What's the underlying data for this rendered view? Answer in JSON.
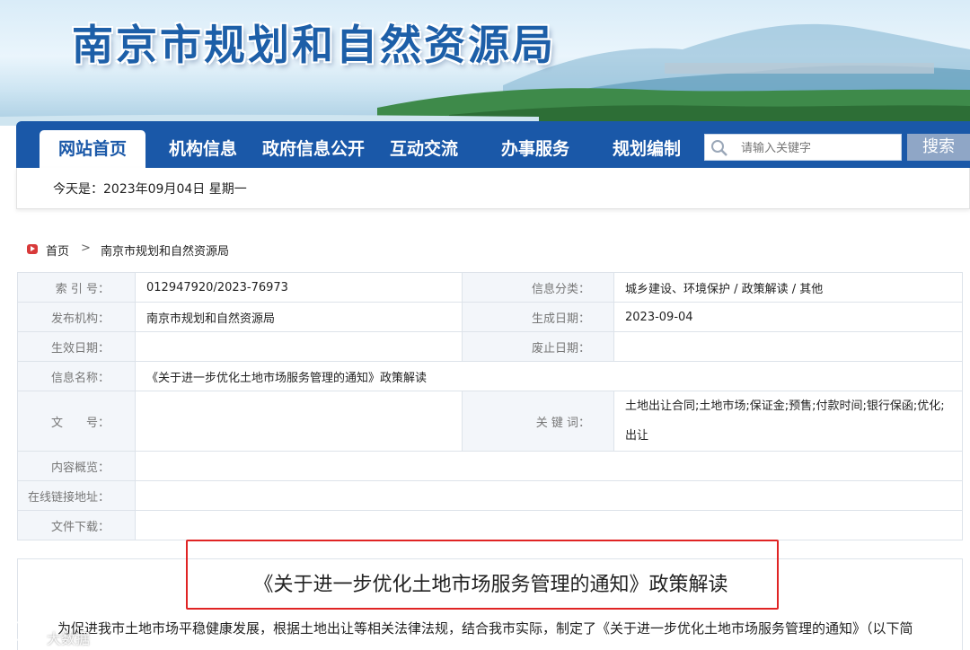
{
  "site": {
    "title": "南京市规划和自然资源局"
  },
  "nav": {
    "items": [
      {
        "label": "网站首页"
      },
      {
        "label": "机构信息"
      },
      {
        "label": "政府信息公开"
      },
      {
        "label": "互动交流"
      },
      {
        "label": "办事服务"
      },
      {
        "label": "规划编制"
      }
    ],
    "search_placeholder": "请输入关键字",
    "search_button": "搜索"
  },
  "datebar": {
    "text": "今天是：2023年09月04日  星期一"
  },
  "breadcrumb": {
    "home": "首页",
    "separator": ">",
    "current": "南京市规划和自然资源局"
  },
  "info": {
    "index_label": "索 引 号：",
    "index_value": "012947920/2023-76973",
    "category_label": "信息分类：",
    "category_value": "城乡建设、环境保护 / 政策解读 / 其他",
    "publisher_label": "发布机构：",
    "publisher_value": "南京市规划和自然资源局",
    "created_label": "生成日期：",
    "created_value": "2023-09-04",
    "effective_label": "生效日期：",
    "effective_value": "",
    "abolished_label": "废止日期：",
    "abolished_value": "",
    "name_label": "信息名称：",
    "name_value": "《关于进一步优化土地市场服务管理的通知》政策解读",
    "docno_label": "文　　号：",
    "docno_value": "",
    "keywords_label": "关 键 词：",
    "keywords_value": "土地出让合同;土地市场;保证金;预售;付款时间;银行保函;优化;出让",
    "summary_label": "内容概览：",
    "summary_value": "",
    "link_label": "在线链接地址：",
    "link_value": "",
    "download_label": "文件下载：",
    "download_value": ""
  },
  "article": {
    "title": "《关于进一步优化土地市场服务管理的通知》政策解读",
    "body_first_line": "为促进我市土地市场平稳健康发展，根据土地出让等相关法律法规，结合我市实际，制定了《关于进一步优化土地市场服务管理的通知》（以下简"
  },
  "watermark": {
    "text": "大数据"
  },
  "colors": {
    "nav_bg": "#1a58a8",
    "highlight_box": "#e02424",
    "table_label_bg": "#f3f6fa"
  }
}
